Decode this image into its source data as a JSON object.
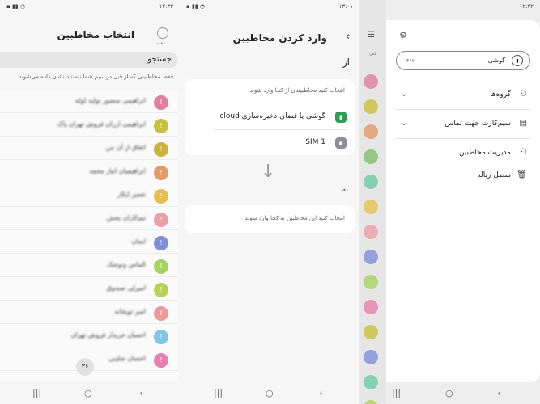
{
  "panel1": {
    "status_left": "۱۲:۳۳",
    "title": "انتخاب مخاطبین",
    "all_label": "همه",
    "search_placeholder": "جستجو",
    "note": "فقط مخاطبینی که از قبل در سیم شما نیستند نشان داده می‌شوند.",
    "contacts": [
      {
        "name": "ابراهیمی منصور تولید لوله",
        "color": "#e07fa0"
      },
      {
        "name": "ابراهیمی ارزان فروش تهران پاک",
        "color": "#c7c23d"
      },
      {
        "name": "اتفاق از آن من",
        "color": "#c9b33d"
      },
      {
        "name": "ابراهیمیان انبار محمد",
        "color": "#e49a6a"
      },
      {
        "name": "تعمیر ایکار",
        "color": "#e6c04f"
      },
      {
        "name": "تیم‌کاران پخش",
        "color": "#eb9fa6"
      },
      {
        "name": "ایمان",
        "color": "#7f8fd9"
      },
      {
        "name": "الماس ونوشک",
        "color": "#a7d35f"
      },
      {
        "name": "امیرلی صندوق",
        "color": "#b7d255"
      },
      {
        "name": "امیر توپخانه",
        "color": "#ef9a98"
      },
      {
        "name": "احسان خریدار فروش تهران",
        "color": "#7fc5e5"
      },
      {
        "name": "احسان صلیبی",
        "color": "#e87fb0"
      }
    ],
    "fab_label": "۳۶",
    "nav": [
      "|||",
      "○",
      "‹"
    ]
  },
  "panel2": {
    "status_left": "۱۳:۰۱",
    "title": "وارد کردن مخاطبین",
    "from_label": "از",
    "from_hint": "انتخاب کنید مخاطبینتان از کجا وارد شوند.",
    "options": [
      {
        "label": "گوشی یا فضای ذخیره‌سازی cloud",
        "icon": "▮",
        "color": "#2d9f55"
      },
      {
        "label": "SIM 1",
        "icon": "▪",
        "color": "#8a8f98"
      }
    ],
    "arrow": "↓",
    "to_label": "به",
    "to_hint": "انتخاب کنید این مخاطبین به کجا وارد شوند.",
    "nav": [
      "|||",
      "○",
      "‹"
    ]
  },
  "panel3": {
    "status_left": "۱۲:۳۲",
    "strip_menu": "☰",
    "strip_label": "تلفن",
    "strip_colors": [
      "#e07fa0",
      "#c7c23d",
      "#e49a6a",
      "#7fbf6a",
      "#6acaa8",
      "#e6c04f",
      "#eb9fa6",
      "#7f8fd9",
      "#a7d35f",
      "#e87fb0",
      "#c7c23d",
      "#7f8fd9",
      "#6acaa8",
      "#b7d255"
    ],
    "account": {
      "name": "گوشی",
      "count": "۴۶۷"
    },
    "menu": [
      {
        "label": "گروه‌ها",
        "icon": "⚇",
        "chevron": "⌄"
      },
      {
        "label": "سیم‌کارت جهت تماس",
        "icon": "▤",
        "chevron": "⌄"
      },
      {
        "label": "مدیریت مخاطبین",
        "icon": "⚇",
        "chevron": ""
      },
      {
        "label": "سطل زباله",
        "icon": "🗑",
        "chevron": ""
      }
    ],
    "nav": [
      "|||",
      "○",
      "‹"
    ]
  }
}
